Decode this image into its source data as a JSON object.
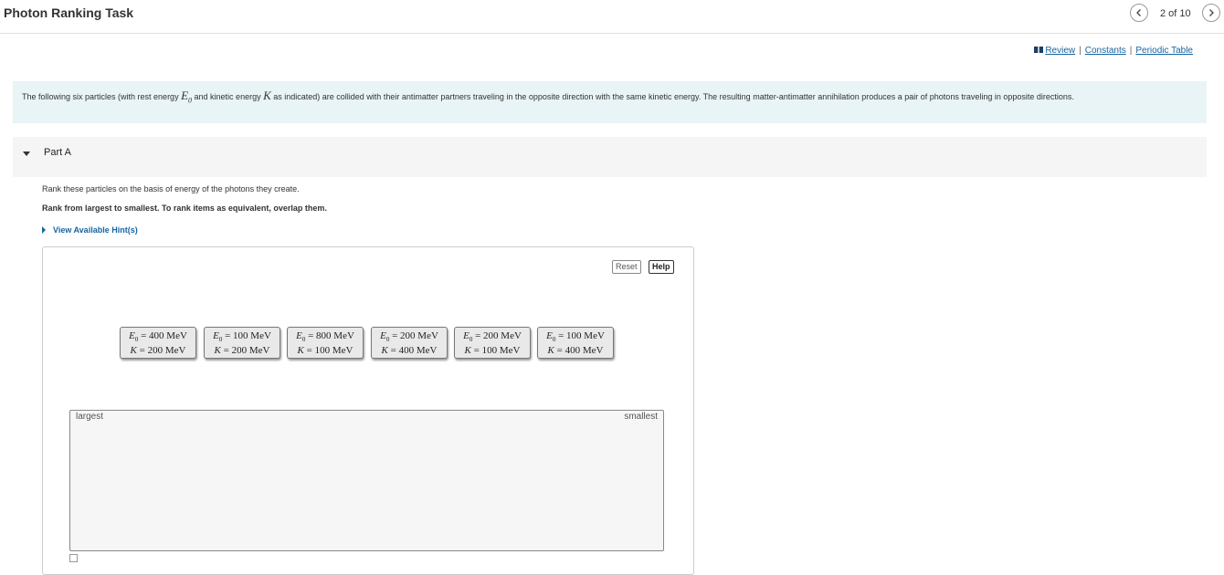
{
  "header": {
    "title": "Photon Ranking Task",
    "counter": "2 of 10"
  },
  "links": {
    "review": "Review",
    "constants": "Constants",
    "periodic_table": "Periodic Table",
    "separator": "|"
  },
  "intro": {
    "text_before_E": "The following six particles (with rest energy ",
    "E_symbol": "E",
    "E_sub": "0",
    "text_between": " and kinetic energy ",
    "K_symbol": "K",
    "text_after": " as indicated) are collided with their antimatter partners traveling in the opposite direction with the same kinetic energy. The resulting matter-antimatter annihilation produces a pair of photons traveling in opposite directions."
  },
  "part": {
    "label": "Part A",
    "instruction": "Rank these particles on the basis of energy of the photons they create.",
    "rank_instruction": "Rank from largest to smallest. To rank items as equivalent, overlap them.",
    "hint_label": "View Available Hint(s)"
  },
  "ranking": {
    "reset_label": "Reset",
    "help_label": "Help",
    "items": [
      {
        "e0": "E0 = 400 MeV",
        "k": "K = 200 MeV"
      },
      {
        "e0": "E0 = 100 MeV",
        "k": "K = 200 MeV"
      },
      {
        "e0": "E0 = 800 MeV",
        "k": "K = 100 MeV"
      },
      {
        "e0": "E0 = 200 MeV",
        "k": "K = 400 MeV"
      },
      {
        "e0": "E0 = 200 MeV",
        "k": "K = 100 MeV"
      },
      {
        "e0": "E0 = 100 MeV",
        "k": "K = 400 MeV"
      }
    ],
    "target_largest": "largest",
    "target_smallest": "smallest"
  },
  "colors": {
    "link": "#1565a0",
    "intro_bg": "#e8f4f5",
    "part_bg": "#f5f5f5",
    "item_bg": "#e9e9e9"
  },
  "icons": [
    "chevron-left-icon",
    "chevron-right-icon",
    "book-icon",
    "caret-down-icon",
    "caret-right-icon"
  ]
}
